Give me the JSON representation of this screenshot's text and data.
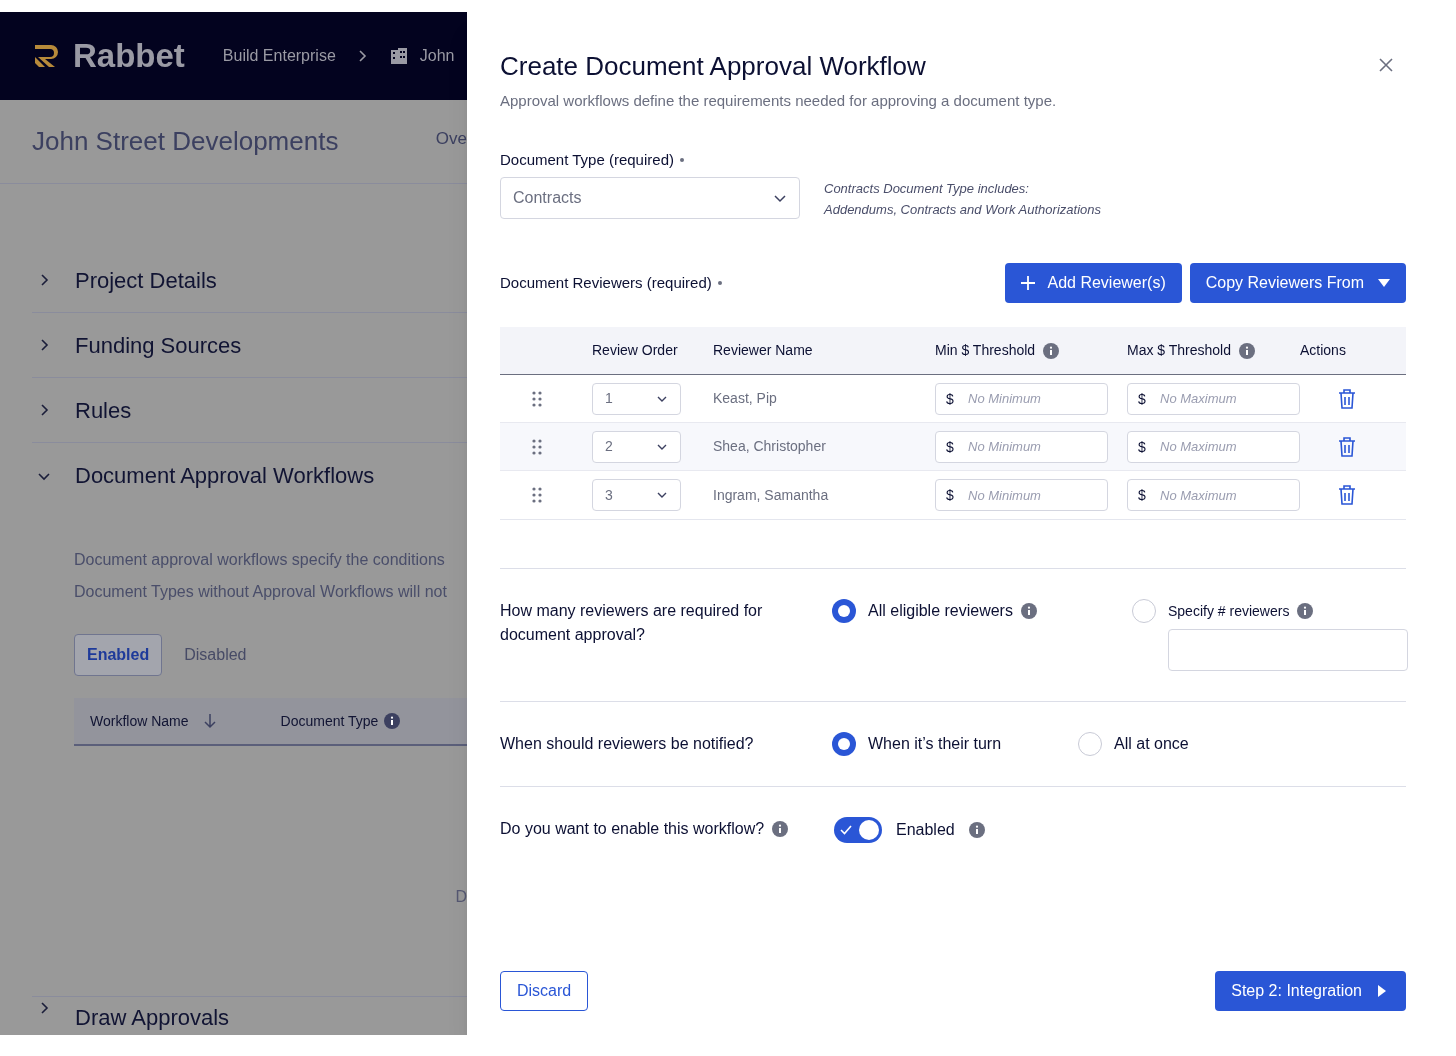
{
  "header": {
    "logo": "Rabbet",
    "breadcrumbs": [
      {
        "label": "Build Enterprise"
      },
      {
        "label": "John"
      }
    ]
  },
  "page": {
    "title": "John Street Developments",
    "nav_tab": "Ove",
    "sections": [
      {
        "label": "Project Details",
        "expanded": false
      },
      {
        "label": "Funding Sources",
        "expanded": false
      },
      {
        "label": "Rules",
        "expanded": false
      },
      {
        "label": "Document Approval Workflows",
        "expanded": true
      }
    ],
    "description": [
      "Document approval workflows specify the conditions",
      "Document Types without Approval Workflows will not"
    ],
    "filter_tabs": [
      {
        "label": "Enabled",
        "selected": true
      },
      {
        "label": "Disabled",
        "selected": false
      }
    ],
    "table_columns": [
      {
        "label": "Workflow Name",
        "kind": "sort"
      },
      {
        "label": "Document Type",
        "kind": "info"
      }
    ],
    "empty_text": "D",
    "next_section": {
      "label": "Draw Approvals",
      "expanded": false
    }
  },
  "modal": {
    "title": "Create Document Approval Workflow",
    "subtitle": "Approval workflows define the requirements needed for approving a document type.",
    "document_type": {
      "label": "Document Type (required)",
      "value": "Contracts",
      "note": [
        "Contracts Document Type includes:",
        "Addendums, Contracts and Work Authorizations"
      ]
    },
    "reviewers": {
      "label": "Document Reviewers (required)",
      "add_button": "Add Reviewer(s)",
      "copy_button": "Copy Reviewers From",
      "columns": [
        {
          "label": "Review Order",
          "info": false
        },
        {
          "label": "Reviewer Name",
          "info": false
        },
        {
          "label": "Min $ Threshold",
          "info": true
        },
        {
          "label": "Max $ Threshold",
          "info": true
        },
        {
          "label": "Actions",
          "info": false
        }
      ],
      "rows": [
        {
          "order": "1",
          "name": "Keast, Pip",
          "min_prefix": "$",
          "min_placeholder": "No Minimum",
          "max_prefix": "$",
          "max_placeholder": "No Maximum"
        },
        {
          "order": "2",
          "name": "Shea, Christopher",
          "min_prefix": "$",
          "min_placeholder": "No Minimum",
          "max_prefix": "$",
          "max_placeholder": "No Maximum"
        },
        {
          "order": "3",
          "name": "Ingram, Samantha",
          "min_prefix": "$",
          "min_placeholder": "No Minimum",
          "max_prefix": "$",
          "max_placeholder": "No Maximum"
        }
      ]
    },
    "questions": [
      {
        "kind": "radio",
        "text": "How many reviewers are required for document approval?",
        "options": [
          {
            "label": "All eligible reviewers",
            "selected": true,
            "info": true,
            "field": false
          },
          {
            "label": "Specify # reviewers",
            "selected": false,
            "info": true,
            "field": true
          }
        ]
      },
      {
        "kind": "radio",
        "text": "When should reviewers be notified?",
        "options": [
          {
            "label": "When it’s their turn",
            "selected": true,
            "info": false,
            "field": false
          },
          {
            "label": "All at once",
            "selected": false,
            "info": false,
            "field": false
          }
        ]
      },
      {
        "kind": "toggle",
        "text": "Do you want to enable this workflow?",
        "info": true,
        "on": true,
        "toggle_label": "Enabled",
        "toggle_info": true
      }
    ],
    "discard_button": "Discard",
    "next_button": "Step 2: Integration"
  }
}
